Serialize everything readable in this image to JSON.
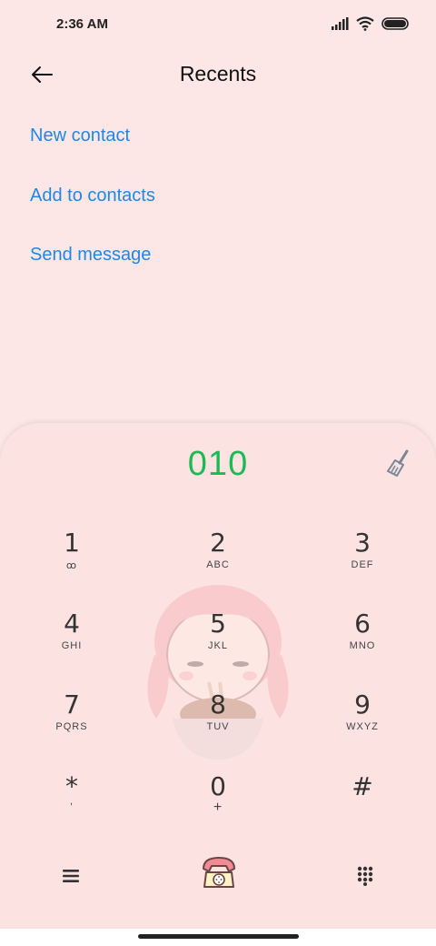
{
  "status_bar": {
    "time": "2:36 AM"
  },
  "header": {
    "title": "Recents"
  },
  "actions": {
    "new_contact": "New contact",
    "add_to_contacts": "Add to contacts",
    "send_message": "Send message"
  },
  "dialer": {
    "number": "010",
    "keys": [
      {
        "digit": "1",
        "letters": "ꝏ"
      },
      {
        "digit": "2",
        "letters": "ABC"
      },
      {
        "digit": "3",
        "letters": "DEF"
      },
      {
        "digit": "4",
        "letters": "GHI"
      },
      {
        "digit": "5",
        "letters": "JKL"
      },
      {
        "digit": "6",
        "letters": "MNO"
      },
      {
        "digit": "7",
        "letters": "PQRS"
      },
      {
        "digit": "8",
        "letters": "TUV"
      },
      {
        "digit": "9",
        "letters": "WXYZ"
      },
      {
        "digit": "*",
        "letters": ","
      },
      {
        "digit": "0",
        "letters": "+"
      },
      {
        "digit": "#",
        "letters": ""
      }
    ]
  },
  "icons": {
    "back": "back-arrow-icon",
    "clear": "broom-icon",
    "menu": "menu-icon",
    "call": "phone-icon",
    "dialpad": "dialpad-icon"
  },
  "colors": {
    "accent": "#1e88e5",
    "number": "#1db954",
    "background": "#fce7e6"
  }
}
